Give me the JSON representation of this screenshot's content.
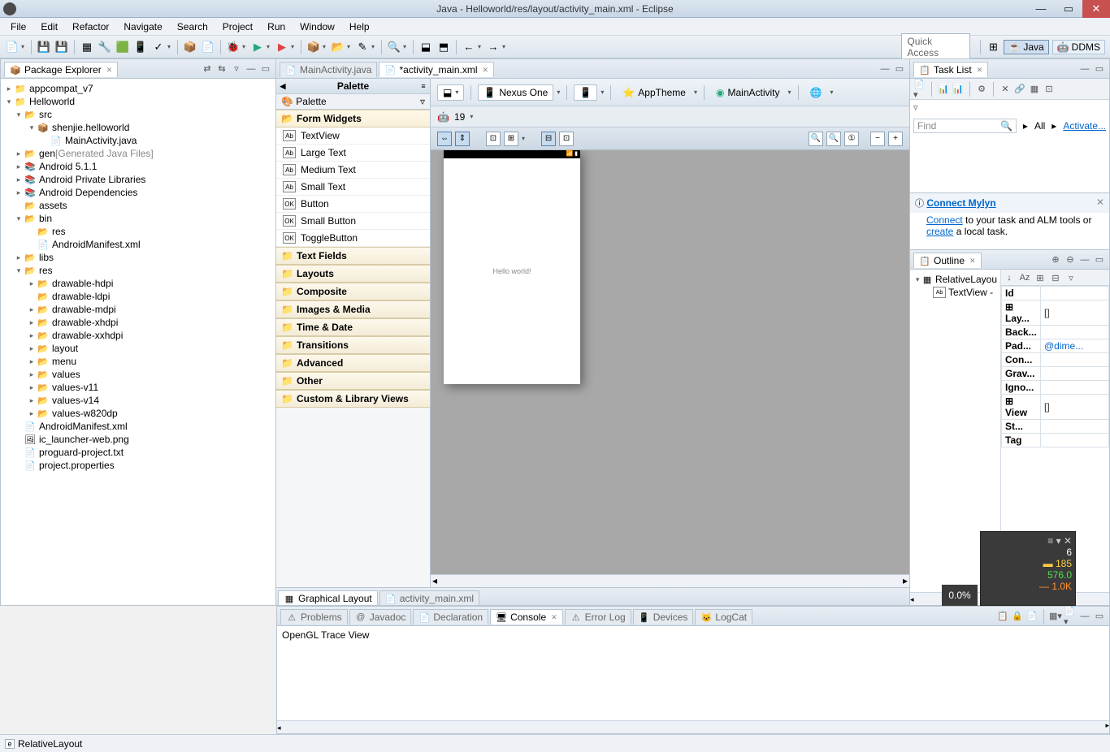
{
  "window": {
    "title": "Java - Helloworld/res/layout/activity_main.xml - Eclipse"
  },
  "menu": [
    "File",
    "Edit",
    "Refactor",
    "Navigate",
    "Search",
    "Project",
    "Run",
    "Window",
    "Help"
  ],
  "quickaccess": "Quick Access",
  "perspectives": {
    "java": "Java",
    "ddms": "DDMS"
  },
  "packageExplorer": {
    "title": "Package Explorer",
    "items": [
      {
        "l": 0,
        "a": "closed",
        "i": "📁",
        "t": "appcompat_v7"
      },
      {
        "l": 0,
        "a": "open",
        "i": "📁",
        "t": "Helloworld"
      },
      {
        "l": 1,
        "a": "open",
        "i": "📂",
        "t": "src"
      },
      {
        "l": 2,
        "a": "open",
        "i": "📦",
        "t": "shenjie.helloworld"
      },
      {
        "l": 3,
        "a": "none",
        "i": "📄",
        "t": "MainActivity.java"
      },
      {
        "l": 1,
        "a": "closed",
        "i": "📂",
        "t": "gen",
        "suffix": "[Generated Java Files]"
      },
      {
        "l": 1,
        "a": "closed",
        "i": "📚",
        "t": "Android 5.1.1"
      },
      {
        "l": 1,
        "a": "closed",
        "i": "📚",
        "t": "Android Private Libraries"
      },
      {
        "l": 1,
        "a": "closed",
        "i": "📚",
        "t": "Android Dependencies"
      },
      {
        "l": 1,
        "a": "none",
        "i": "📂",
        "t": "assets"
      },
      {
        "l": 1,
        "a": "open",
        "i": "📂",
        "t": "bin"
      },
      {
        "l": 2,
        "a": "none",
        "i": "📂",
        "t": "res"
      },
      {
        "l": 2,
        "a": "none",
        "i": "📄",
        "t": "AndroidManifest.xml"
      },
      {
        "l": 1,
        "a": "closed",
        "i": "📂",
        "t": "libs"
      },
      {
        "l": 1,
        "a": "open",
        "i": "📂",
        "t": "res"
      },
      {
        "l": 2,
        "a": "closed",
        "i": "📂",
        "t": "drawable-hdpi"
      },
      {
        "l": 2,
        "a": "none",
        "i": "📂",
        "t": "drawable-ldpi"
      },
      {
        "l": 2,
        "a": "closed",
        "i": "📂",
        "t": "drawable-mdpi"
      },
      {
        "l": 2,
        "a": "closed",
        "i": "📂",
        "t": "drawable-xhdpi"
      },
      {
        "l": 2,
        "a": "closed",
        "i": "📂",
        "t": "drawable-xxhdpi"
      },
      {
        "l": 2,
        "a": "closed",
        "i": "📂",
        "t": "layout"
      },
      {
        "l": 2,
        "a": "closed",
        "i": "📂",
        "t": "menu"
      },
      {
        "l": 2,
        "a": "closed",
        "i": "📂",
        "t": "values"
      },
      {
        "l": 2,
        "a": "closed",
        "i": "📂",
        "t": "values-v11"
      },
      {
        "l": 2,
        "a": "closed",
        "i": "📂",
        "t": "values-v14"
      },
      {
        "l": 2,
        "a": "closed",
        "i": "📂",
        "t": "values-w820dp"
      },
      {
        "l": 1,
        "a": "none",
        "i": "📄",
        "t": "AndroidManifest.xml"
      },
      {
        "l": 1,
        "a": "none",
        "i": "🖼",
        "t": "ic_launcher-web.png"
      },
      {
        "l": 1,
        "a": "none",
        "i": "📄",
        "t": "proguard-project.txt"
      },
      {
        "l": 1,
        "a": "none",
        "i": "📄",
        "t": "project.properties"
      }
    ]
  },
  "editor": {
    "tabs": {
      "main": "MainActivity.java",
      "xml": "*activity_main.xml"
    },
    "palette": {
      "title": "Palette",
      "sub": "Palette",
      "openCat": "Form Widgets",
      "widgets": [
        "TextView",
        "Large Text",
        "Medium Text",
        "Small Text",
        "Button",
        "Small Button",
        "ToggleButton"
      ],
      "cats": [
        "Text Fields",
        "Layouts",
        "Composite",
        "Images & Media",
        "Time & Date",
        "Transitions",
        "Advanced",
        "Other",
        "Custom & Library Views"
      ]
    },
    "config": {
      "device": "Nexus One",
      "theme": "AppTheme",
      "activity": "MainActivity",
      "api": "19"
    },
    "canvas": {
      "hello": "Hello world!"
    },
    "bottomTabs": {
      "graphical": "Graphical Layout",
      "xml": "activity_main.xml"
    }
  },
  "tasklist": {
    "title": "Task List",
    "find": "Find",
    "all": "All",
    "activate": "Activate..."
  },
  "mylyn": {
    "title": "Connect Mylyn",
    "text1a": "Connect",
    "text1b": " to your task and ALM tools or ",
    "text1c": "create",
    "text1d": " a local task."
  },
  "outline": {
    "title": "Outline",
    "root": "RelativeLayou",
    "child": "TextView -",
    "props": [
      {
        "k": "Id",
        "v": ""
      },
      {
        "k": "Lay...",
        "v": "[]"
      },
      {
        "k": "Back...",
        "v": ""
      },
      {
        "k": "Pad...",
        "v": "@dime..."
      },
      {
        "k": "Con...",
        "v": ""
      },
      {
        "k": "Grav...",
        "v": ""
      },
      {
        "k": "Igno...",
        "v": ""
      },
      {
        "k": "View",
        "v": "[]"
      },
      {
        "k": "St...",
        "v": ""
      },
      {
        "k": "Tag",
        "v": ""
      }
    ]
  },
  "console": {
    "tabs": [
      "Problems",
      "Javadoc",
      "Declaration",
      "Console",
      "Error Log",
      "Devices",
      "LogCat"
    ],
    "activeIdx": 3,
    "body": "OpenGL Trace View"
  },
  "statusbar": {
    "text": "RelativeLayout",
    "icon": "e"
  },
  "perf": {
    "pct": "0.0%",
    "v1": "6",
    "v2": "185",
    "v3": "576.0",
    "v4": "1.0K"
  }
}
